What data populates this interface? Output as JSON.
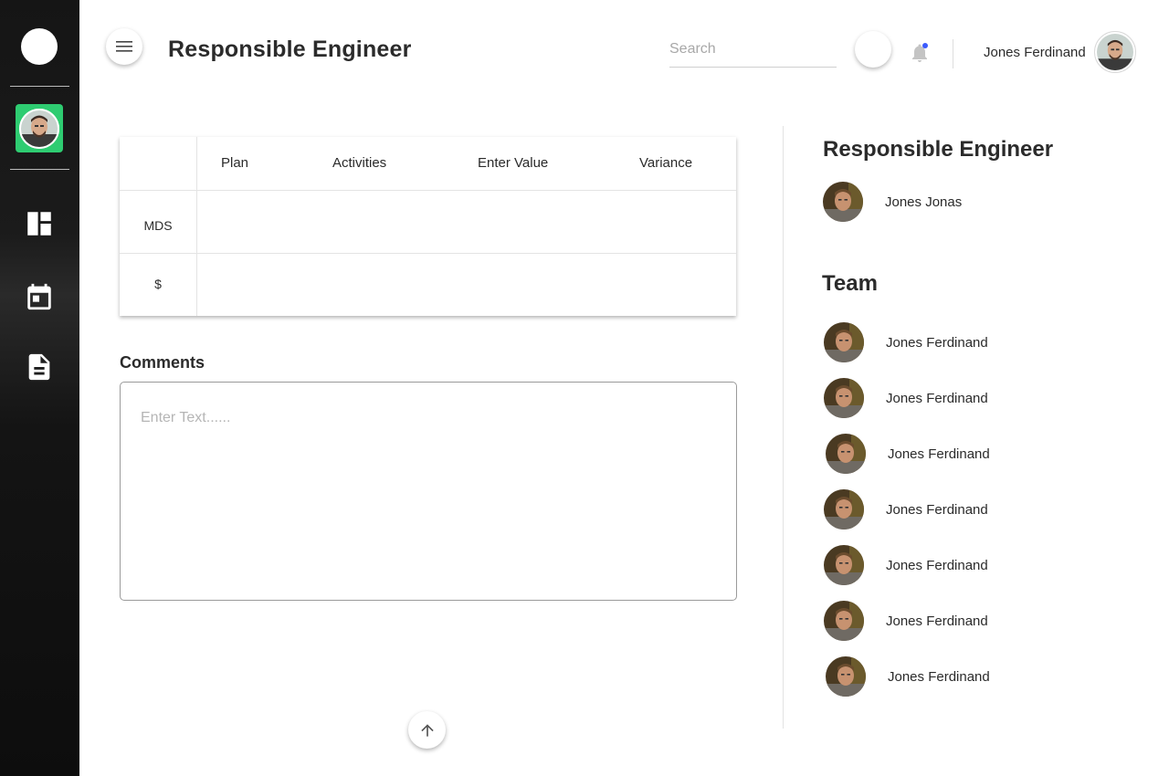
{
  "header": {
    "title": "Responsible Engineer",
    "search_placeholder": "Search",
    "user_name": "Jones Ferdinand"
  },
  "sidebar": {
    "items": [
      {
        "icon": "dashboard-icon"
      },
      {
        "icon": "calendar-icon"
      },
      {
        "icon": "document-icon"
      }
    ]
  },
  "table": {
    "columns": [
      "Plan",
      "Activities",
      "Enter Value",
      "Variance"
    ],
    "rows": [
      "MDS",
      "$"
    ]
  },
  "comments": {
    "label": "Comments",
    "placeholder": "Enter Text......"
  },
  "responsible": {
    "title": "Responsible Engineer",
    "name": "Jones Jonas"
  },
  "team": {
    "title": "Team",
    "members": [
      "Jones Ferdinand",
      "Jones Ferdinand",
      "Jones Ferdinand",
      "Jones Ferdinand",
      "Jones Ferdinand",
      "Jones Ferdinand",
      "Jones Ferdinand"
    ]
  },
  "colors": {
    "sidebar_avatar_bg": "#2ecc71",
    "notification_dot": "#3b5bfd"
  }
}
